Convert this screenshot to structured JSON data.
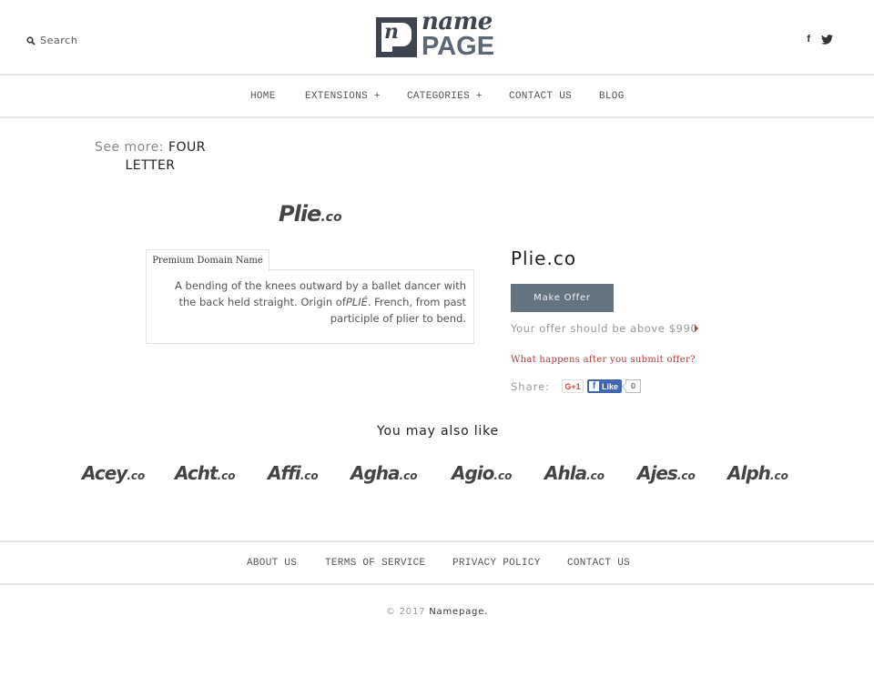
{
  "header": {
    "search_label": "Search",
    "search_icon": "search-icon",
    "logo": {
      "top_text": "name",
      "bottom_text": "PAGE",
      "mark_letter": "n"
    },
    "social": [
      {
        "name": "facebook",
        "icon": "facebook-icon",
        "glyph": "f"
      },
      {
        "name": "twitter",
        "icon": "twitter-icon"
      }
    ]
  },
  "nav": {
    "items": [
      {
        "label": "HOME"
      },
      {
        "label": "EXTENSIONS +"
      },
      {
        "label": "CATEGORIES +"
      },
      {
        "label": "CONTACT US"
      },
      {
        "label": "BLOG"
      }
    ]
  },
  "see_more": {
    "label": "See more:",
    "link": "FOUR LETTER"
  },
  "domain": {
    "logo_main": "Plie",
    "logo_tld": ".co",
    "title": "Plie.co",
    "tab_label": "Premium Domain Name",
    "description_before": "A bending of the knees outward by a ballet dancer with the back held straight. Origin of",
    "description_em": "PLIÉ",
    "description_after": ". French, from past participle of plier to bend."
  },
  "offer": {
    "button_label": "Make Offer",
    "note": "Your offer should be above $990",
    "min_price": "$990",
    "help_link": "What happens after you submit offer?",
    "accent_color": "#b03a3a"
  },
  "share": {
    "label": "Share:",
    "gplus_label": "G+1",
    "fb_like_label": "Like",
    "fb_like_count": "0"
  },
  "related": {
    "heading": "You may also like",
    "items": [
      {
        "main": "Acey",
        "tld": ".co"
      },
      {
        "main": "Acht",
        "tld": ".co"
      },
      {
        "main": "Affi",
        "tld": ".co"
      },
      {
        "main": "Agha",
        "tld": ".co"
      },
      {
        "main": "Agio",
        "tld": ".co"
      },
      {
        "main": "Ahla",
        "tld": ".co"
      },
      {
        "main": "Ajes",
        "tld": ".co"
      },
      {
        "main": "Alph",
        "tld": ".co"
      }
    ]
  },
  "footer": {
    "links": [
      {
        "label": "ABOUT US"
      },
      {
        "label": "TERMS OF SERVICE"
      },
      {
        "label": "PRIVACY POLICY"
      },
      {
        "label": "CONTACT US"
      }
    ],
    "copyright_prefix": "© 2017",
    "copyright_brand": "Namepage."
  },
  "colors": {
    "button_bg": "#667480",
    "logo_dark": "#3f4550",
    "logo_page": "#5b6775",
    "facebook_blue": "#4267b2",
    "gplus_red": "#d14836"
  }
}
